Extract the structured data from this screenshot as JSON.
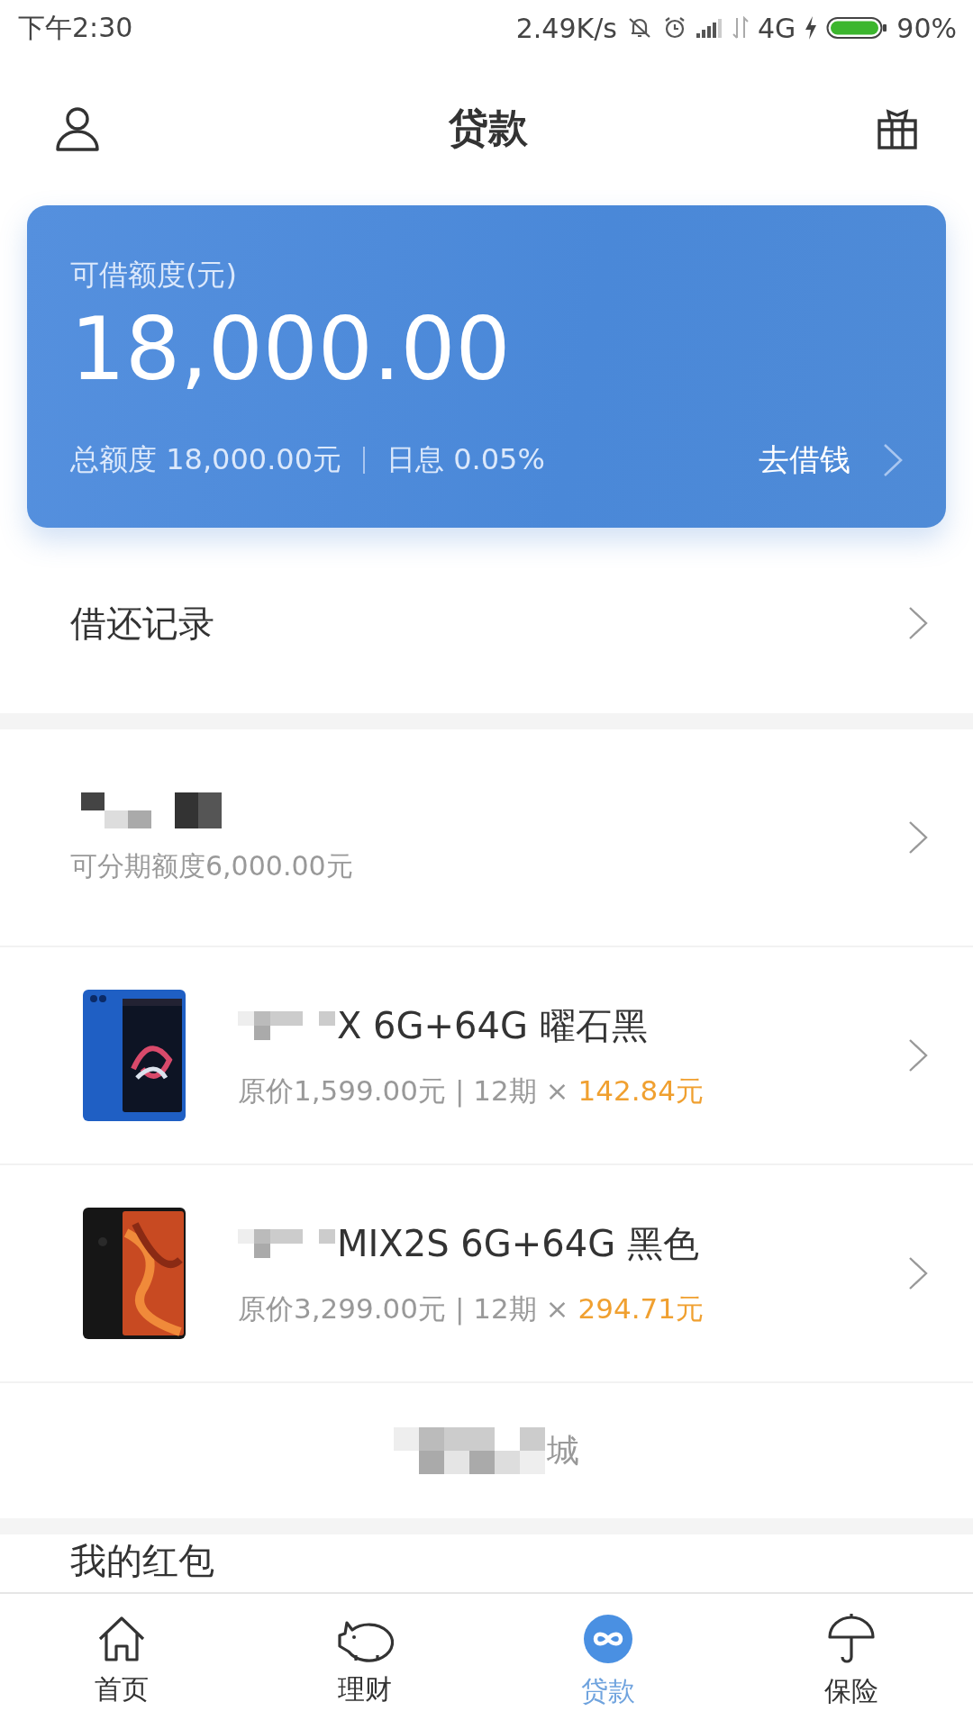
{
  "status_bar": {
    "time": "下午2:30",
    "speed": "2.49K/s",
    "network": "4G",
    "battery": "90%"
  },
  "header": {
    "title": "贷款"
  },
  "credit_card": {
    "label": "可借额度(元)",
    "amount": "18,000.00",
    "total": "总额度 18,000.00元",
    "interest": "日息 0.05%",
    "action": "去借钱"
  },
  "records": {
    "label": "借还记录"
  },
  "installment": {
    "subtitle": "可分期额度6,000.00元"
  },
  "products": [
    {
      "name": "X 6G+64G 曜石黑",
      "price": "原价1,599.00元 | 12期 ×",
      "monthly": "142.84元",
      "kind": "blue"
    },
    {
      "name": "MIX2S 6G+64G 黑色",
      "price": "原价3,299.00元 | 12期 ×",
      "monthly": "294.71元",
      "kind": "black"
    }
  ],
  "mall": {
    "label": "城"
  },
  "red_packet": {
    "label": "我的红包"
  },
  "tabs": [
    {
      "label": "首页",
      "kind": "home",
      "selected": false
    },
    {
      "label": "理财",
      "kind": "piggy",
      "selected": false
    },
    {
      "label": "贷款",
      "kind": "loan",
      "selected": true
    },
    {
      "label": "保险",
      "kind": "umbrella",
      "selected": false
    }
  ]
}
